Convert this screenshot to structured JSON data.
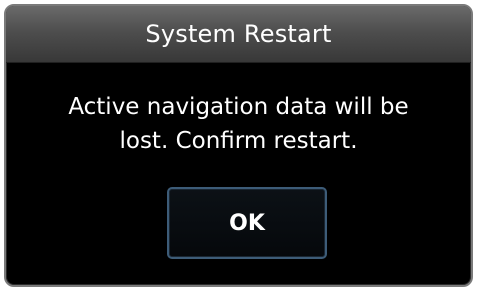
{
  "dialog": {
    "title": "System Restart",
    "message_lines": [
      "Active navigation data will be",
      "lost. Confirm restart."
    ],
    "ok_label": "OK"
  },
  "colors": {
    "background": "#000000",
    "title_bar": "#4e4e4e",
    "button_border": "#3d5c78",
    "text": "#ffffff"
  }
}
